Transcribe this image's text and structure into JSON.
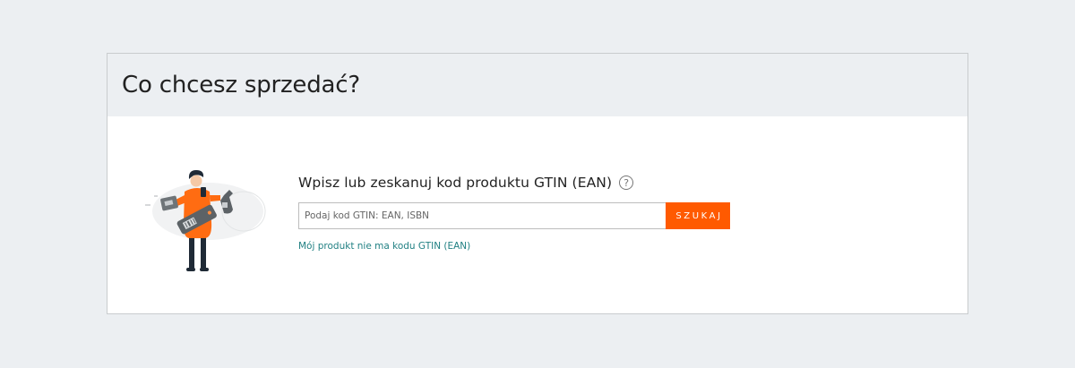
{
  "card": {
    "title": "Co chcesz sprzedać?"
  },
  "search": {
    "prompt": "Wpisz lub zeskanuj kod produktu GTIN (EAN)",
    "help_symbol": "?",
    "placeholder": "Podaj kod GTIN: EAN, ISBN",
    "value": "",
    "button_label": "SZUKAJ",
    "no_gtin_link": "Mój produkt nie ma kodu GTIN (EAN)"
  },
  "colors": {
    "accent": "#ff5a00",
    "link": "#218083",
    "page_background": "#eceff2"
  },
  "icons": [
    "help-icon",
    "product-scanning-illustration"
  ]
}
